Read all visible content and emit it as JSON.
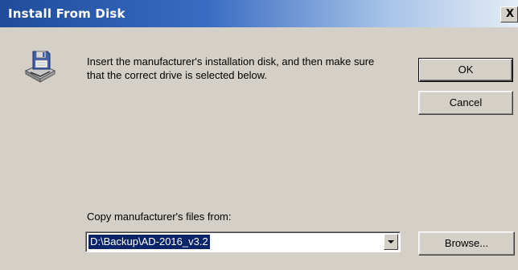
{
  "window": {
    "title": "Install From Disk",
    "close_glyph": "X"
  },
  "message": "Insert the manufacturer's installation disk, and then make sure that the correct drive is selected below.",
  "icon": "floppy-disk-drive-icon",
  "buttons": {
    "ok_label": "OK",
    "cancel_label": "Cancel",
    "browse_label": "Browse..."
  },
  "copy_from": {
    "label": "Copy manufacturer's files from:",
    "value": "D:\\Backup\\AD-2016_v3.2"
  },
  "colors": {
    "title_bar_start": "#1f4c9a",
    "title_bar_end": "#e4ecf6",
    "dialog_background": "#d4d0c8",
    "selection_highlight": "#0a246a"
  }
}
